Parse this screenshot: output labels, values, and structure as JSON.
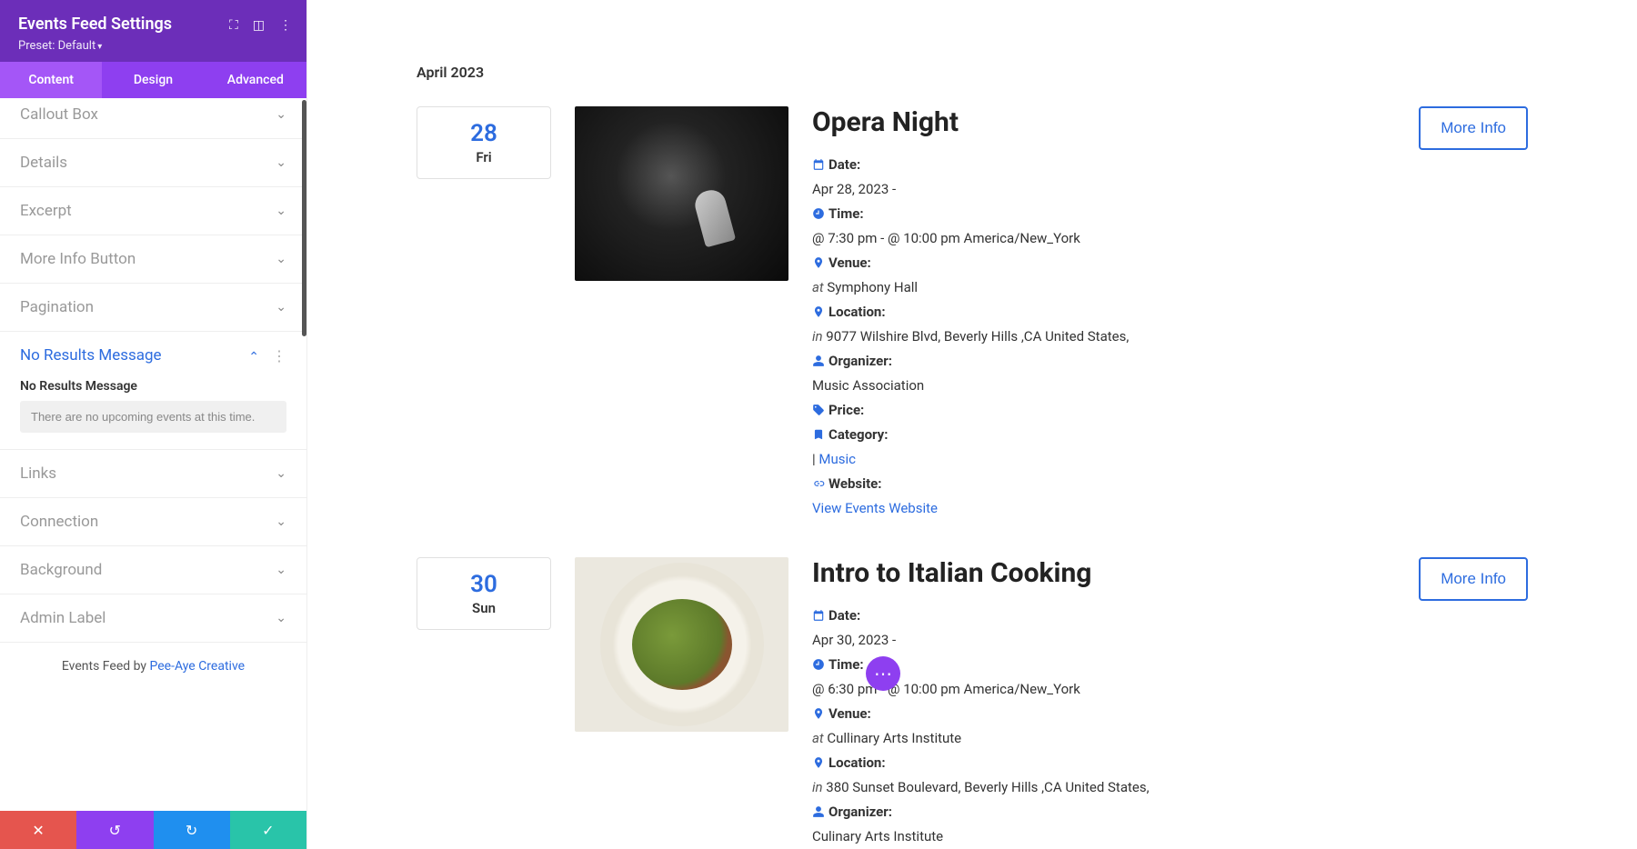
{
  "sidebar": {
    "title": "Events Feed Settings",
    "preset_label": "Preset: Default",
    "header_icons": {
      "expand": "⛶",
      "layout": "◫",
      "more": "⋮"
    },
    "tabs": [
      "Content",
      "Design",
      "Advanced"
    ],
    "active_tab": 0,
    "sections": [
      {
        "label": "Callout Box",
        "expanded": false
      },
      {
        "label": "Details",
        "expanded": false
      },
      {
        "label": "Excerpt",
        "expanded": false
      },
      {
        "label": "More Info Button",
        "expanded": false
      },
      {
        "label": "Pagination",
        "expanded": false
      },
      {
        "label": "No Results Message",
        "expanded": true,
        "field_label": "No Results Message",
        "field_value": "There are no upcoming events at this time."
      },
      {
        "label": "Links",
        "expanded": false
      },
      {
        "label": "Connection",
        "expanded": false
      },
      {
        "label": "Background",
        "expanded": false
      },
      {
        "label": "Admin Label",
        "expanded": false
      }
    ],
    "footer_text_prefix": "Events Feed by ",
    "footer_link": "Pee-Aye Creative"
  },
  "actions": {
    "cancel": "✕",
    "undo": "↺",
    "redo": "↻",
    "save": "✓"
  },
  "preview": {
    "month_label": "April 2023",
    "more_info_label": "More Info",
    "labels": {
      "date": "Date:",
      "time": "Time:",
      "venue": "Venue:",
      "location": "Location:",
      "organizer": "Organizer:",
      "price": "Price:",
      "category": "Category:",
      "website": "Website:"
    },
    "events": [
      {
        "day_num": "28",
        "day_name": "Fri",
        "title": "Opera Night",
        "date_text": "Apr 28, 2023 -",
        "time_text": "@ 7:30 pm - @ 10:00 pm America/New_York",
        "venue_prefix": "at ",
        "venue": "Symphony Hall",
        "location_prefix": "in ",
        "location": "9077 Wilshire Blvd, Beverly Hills ,CA United States,",
        "organizer": "Music Association",
        "category_prefix": "| ",
        "category": "Music",
        "website_link": "View Events Website",
        "image": "opera"
      },
      {
        "day_num": "30",
        "day_name": "Sun",
        "title": "Intro to Italian Cooking",
        "date_text": "Apr 30, 2023 -",
        "time_text": "@ 6:30 pm - @ 10:00 pm America/New_York",
        "venue_prefix": "at ",
        "venue": "Cullinary Arts Institute",
        "location_prefix": "in ",
        "location": "380 Sunset Boulevard, Beverly Hills ,CA United States,",
        "organizer": "Culinary Arts Institute",
        "image": "pasta"
      }
    ]
  },
  "fab_icon": "⋯"
}
